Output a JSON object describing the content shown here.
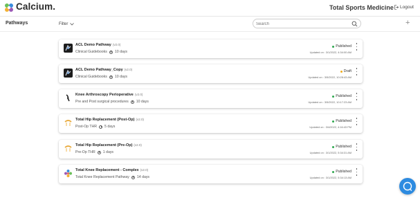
{
  "header": {
    "brand": "Calcium.",
    "org_name": "Total Sports Medicine",
    "logout_label": "Logout"
  },
  "toolbar": {
    "section_title": "Pathways",
    "filter_label": "Filter",
    "search_placeholder": "Search",
    "add_label": "+"
  },
  "colors": {
    "published": "#2fa84f",
    "draft": "#f0ad1e",
    "chat": "#2d8be0"
  },
  "pathways": [
    {
      "title": "ACL Demo Pathway",
      "version": "(v2.0)",
      "category": "Clinical Guidebooks",
      "duration": "10 days",
      "status": "Published",
      "status_color": "#2fa84f",
      "updated": "Updated on : 3/1/2022, 4:34:00 AM",
      "icon": "acl-icon"
    },
    {
      "title": "ACL Demo Pathway_Copy",
      "version": "(v2.0)",
      "category": "Clinical Guidebooks",
      "duration": "10 days",
      "status": "Draft",
      "status_color": "#f0ad1e",
      "updated": "Updated on : 3/5/2022, 10:28:43 AM",
      "icon": "acl-icon"
    },
    {
      "title": "Knee Arthroscopy Perioperative",
      "version": "(v2.0)",
      "category": "Pre and Post surgical procedures",
      "duration": "10 days",
      "status": "Published",
      "status_color": "#2fa84f",
      "updated": "Updated on : 3/5/2022, 10:17:23 AM",
      "icon": "knee-icon"
    },
    {
      "title": "Total Hip Replacement (Post-Op)",
      "version": "(v2.0)",
      "category": "Post-Op THR",
      "duration": "5 days",
      "status": "Published",
      "status_color": "#2fa84f",
      "updated": "Updated on : 3/4/2022, 4:16:43 PM",
      "icon": "hip-icon"
    },
    {
      "title": "Total Hip Replacement (Pre-Op)",
      "version": "(v2.0)",
      "category": "Pre-Op THR",
      "duration": "1 days",
      "status": "Published",
      "status_color": "#2fa84f",
      "updated": "Updated on : 3/1/2022, 5:34:31 AM",
      "icon": "hip-icon"
    },
    {
      "title": "Total Knee Replacement - Complex",
      "version": "(v2.0)",
      "category": "Total Knee Replacement Pathway",
      "duration": "14 days",
      "status": "Published",
      "status_color": "#2fa84f",
      "updated": "Updated on : 3/1/2022, 5:34:13 AM",
      "icon": "flower-icon"
    }
  ]
}
